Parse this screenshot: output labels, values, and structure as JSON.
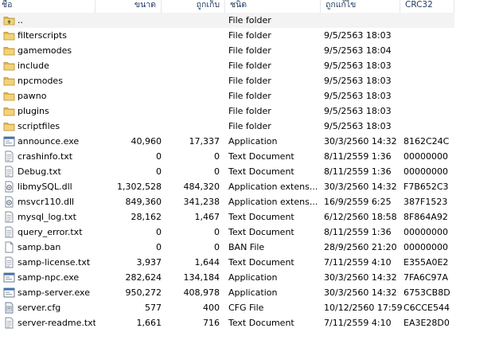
{
  "columns": {
    "name": "ชื่อ",
    "size": "ขนาด",
    "packed": "ถูกเก็บ",
    "type": "ชนิด",
    "modified": "ถูกแก้ไข",
    "crc": "CRC32"
  },
  "rows": [
    {
      "name": "..",
      "size": "",
      "packed": "",
      "type": "File folder",
      "modified": "",
      "crc": "",
      "icon": "folder-up-icon"
    },
    {
      "name": "filterscripts",
      "size": "",
      "packed": "",
      "type": "File folder",
      "modified": "9/5/2563 18:03",
      "crc": "",
      "icon": "folder-icon"
    },
    {
      "name": "gamemodes",
      "size": "",
      "packed": "",
      "type": "File folder",
      "modified": "9/5/2563 18:04",
      "crc": "",
      "icon": "folder-icon"
    },
    {
      "name": "include",
      "size": "",
      "packed": "",
      "type": "File folder",
      "modified": "9/5/2563 18:03",
      "crc": "",
      "icon": "folder-icon"
    },
    {
      "name": "npcmodes",
      "size": "",
      "packed": "",
      "type": "File folder",
      "modified": "9/5/2563 18:03",
      "crc": "",
      "icon": "folder-icon"
    },
    {
      "name": "pawno",
      "size": "",
      "packed": "",
      "type": "File folder",
      "modified": "9/5/2563 18:03",
      "crc": "",
      "icon": "folder-icon"
    },
    {
      "name": "plugins",
      "size": "",
      "packed": "",
      "type": "File folder",
      "modified": "9/5/2563 18:03",
      "crc": "",
      "icon": "folder-icon"
    },
    {
      "name": "scriptfiles",
      "size": "",
      "packed": "",
      "type": "File folder",
      "modified": "9/5/2563 18:03",
      "crc": "",
      "icon": "folder-icon"
    },
    {
      "name": "announce.exe",
      "size": "40,960",
      "packed": "17,337",
      "type": "Application",
      "modified": "30/3/2560 14:32",
      "crc": "8162C24C",
      "icon": "application-icon"
    },
    {
      "name": "crashinfo.txt",
      "size": "0",
      "packed": "0",
      "type": "Text Document",
      "modified": "8/11/2559 1:36",
      "crc": "00000000",
      "icon": "text-document-icon"
    },
    {
      "name": "Debug.txt",
      "size": "0",
      "packed": "0",
      "type": "Text Document",
      "modified": "8/11/2559 1:36",
      "crc": "00000000",
      "icon": "text-document-icon"
    },
    {
      "name": "libmySQL.dll",
      "size": "1,302,528",
      "packed": "484,320",
      "type": "Application extens...",
      "modified": "30/3/2560 14:32",
      "crc": "F7B652C3",
      "icon": "dll-icon"
    },
    {
      "name": "msvcr110.dll",
      "size": "849,360",
      "packed": "341,238",
      "type": "Application extens...",
      "modified": "16/9/2559 6:25",
      "crc": "387F1523",
      "icon": "dll-icon"
    },
    {
      "name": "mysql_log.txt",
      "size": "28,162",
      "packed": "1,467",
      "type": "Text Document",
      "modified": "6/12/2560 18:58",
      "crc": "8F864A92",
      "icon": "text-document-icon"
    },
    {
      "name": "query_error.txt",
      "size": "0",
      "packed": "0",
      "type": "Text Document",
      "modified": "8/11/2559 1:36",
      "crc": "00000000",
      "icon": "text-document-icon"
    },
    {
      "name": "samp.ban",
      "size": "0",
      "packed": "0",
      "type": "BAN File",
      "modified": "28/9/2560 21:20",
      "crc": "00000000",
      "icon": "blank-file-icon"
    },
    {
      "name": "samp-license.txt",
      "size": "3,937",
      "packed": "1,644",
      "type": "Text Document",
      "modified": "7/11/2559 4:10",
      "crc": "E355A0E2",
      "icon": "text-document-icon"
    },
    {
      "name": "samp-npc.exe",
      "size": "282,624",
      "packed": "134,184",
      "type": "Application",
      "modified": "30/3/2560 14:32",
      "crc": "7FA6C97A",
      "icon": "application-icon"
    },
    {
      "name": "samp-server.exe",
      "size": "950,272",
      "packed": "408,978",
      "type": "Application",
      "modified": "30/3/2560 14:32",
      "crc": "6753CB8D",
      "icon": "application-icon"
    },
    {
      "name": "server.cfg",
      "size": "577",
      "packed": "400",
      "type": "CFG File",
      "modified": "10/12/2560 17:59",
      "crc": "C6CCE544",
      "icon": "config-file-icon"
    },
    {
      "name": "server-readme.txt",
      "size": "1,661",
      "packed": "716",
      "type": "Text Document",
      "modified": "7/11/2559 4:10",
      "crc": "EA3E28D0",
      "icon": "text-document-icon"
    }
  ],
  "colors": {
    "header_text": "#1e3a5f",
    "selected_row": "#f3f3f3",
    "folder": "#e8c15a"
  }
}
